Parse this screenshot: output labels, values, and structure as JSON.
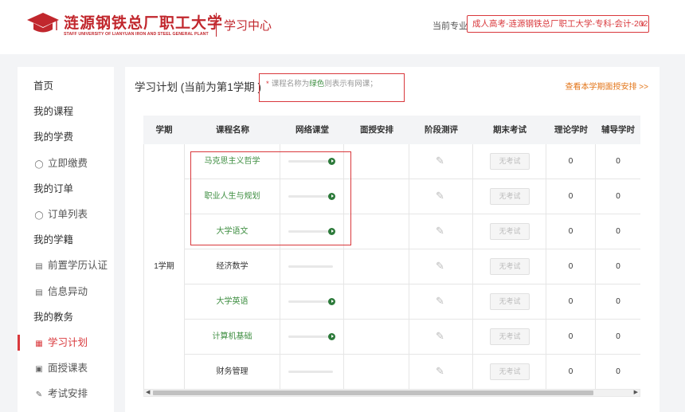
{
  "header": {
    "logo_cn": "涟源钢铁总厂职工大学",
    "logo_en": "STAFF UNIVERSITY OF LIANYUAN IRON AND STEEL GENERAL PLANT",
    "subtitle": "学习中心",
    "major_label": "当前专业",
    "major_value": "成人高考-涟源钢铁总厂职工大学-专科-会计-2021"
  },
  "sidebar": {
    "items": [
      {
        "label": "首页",
        "icon": "",
        "type": "top"
      },
      {
        "label": "我的课程",
        "icon": "",
        "type": "top"
      },
      {
        "label": "我的学费",
        "icon": "",
        "type": "top"
      },
      {
        "label": "立即缴费",
        "icon": "coin-icon",
        "type": "sub"
      },
      {
        "label": "我的订单",
        "icon": "",
        "type": "top"
      },
      {
        "label": "订单列表",
        "icon": "coin-icon",
        "type": "sub"
      },
      {
        "label": "我的学籍",
        "icon": "",
        "type": "top"
      },
      {
        "label": "前置学历认证",
        "icon": "document-icon",
        "type": "sub"
      },
      {
        "label": "信息异动",
        "icon": "document-icon",
        "type": "sub"
      },
      {
        "label": "我的教务",
        "icon": "",
        "type": "top"
      },
      {
        "label": "学习计划",
        "icon": "grid-icon",
        "type": "sub",
        "active": true
      },
      {
        "label": "面授课表",
        "icon": "calendar-icon",
        "type": "sub"
      },
      {
        "label": "考试安排",
        "icon": "edit-icon",
        "type": "sub"
      }
    ]
  },
  "main": {
    "title": "学习计划 (当前为第1学期 )",
    "note_star": "*",
    "note_prefix": "课程名称为",
    "note_green": "绿色",
    "note_suffix": "则表示有网课；",
    "view_link": "查看本学期面授安排 >>",
    "table": {
      "headers": [
        "学期",
        "课程名称",
        "网络课堂",
        "面授安排",
        "阶段测评",
        "期末考试",
        "理论学时",
        "辅导学时"
      ],
      "term": "1学期",
      "final_button": "无考试",
      "rows": [
        {
          "name": "马克思主义哲学",
          "online": true,
          "theory": "0",
          "tutor": "0"
        },
        {
          "name": "职业人生与规划",
          "online": true,
          "theory": "0",
          "tutor": "0"
        },
        {
          "name": "大学语文",
          "online": true,
          "theory": "0",
          "tutor": "0"
        },
        {
          "name": "经济数学",
          "online": false,
          "theory": "0",
          "tutor": "0"
        },
        {
          "name": "大学英语",
          "online": true,
          "theory": "0",
          "tutor": "0"
        },
        {
          "name": "计算机基础",
          "online": true,
          "theory": "0",
          "tutor": "0"
        },
        {
          "name": "财务管理",
          "online": false,
          "theory": "0",
          "tutor": "0"
        }
      ]
    }
  },
  "colors": {
    "brand_red": "#c1272d",
    "accent_red": "#d9383c",
    "online_green": "#3e8e41",
    "link_orange": "#e3761a"
  }
}
